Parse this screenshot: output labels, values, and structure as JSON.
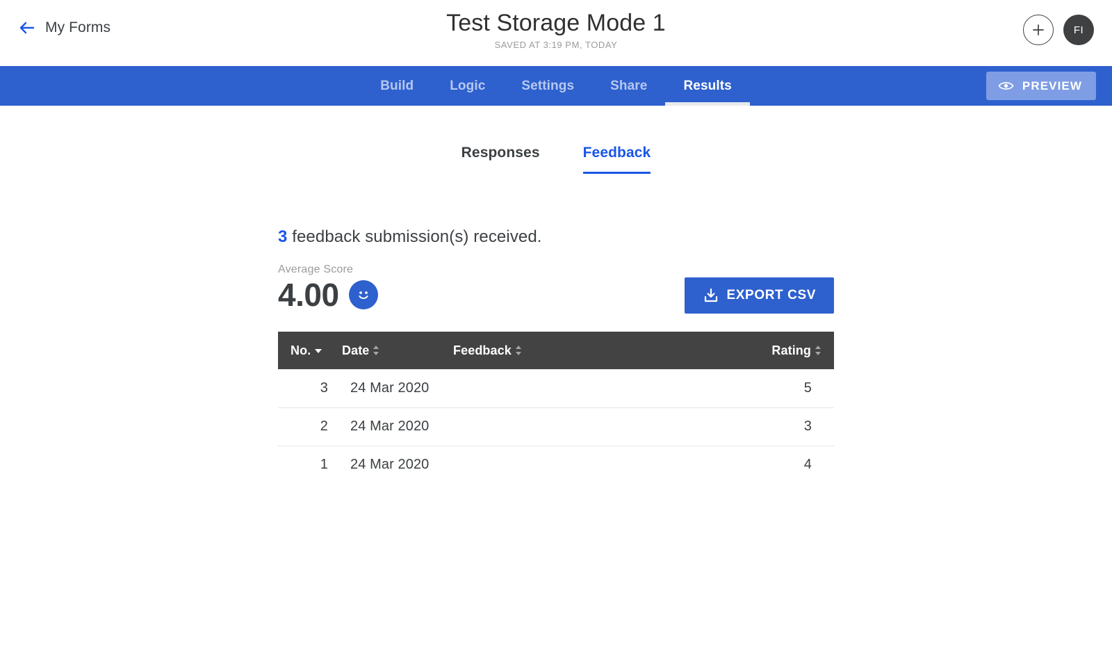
{
  "header": {
    "back_label": "My Forms",
    "back_icon": "arrow-left-icon",
    "title": "Test Storage Mode 1",
    "saved_text": "SAVED AT 3:19 PM, TODAY",
    "add_icon": "plus-icon",
    "avatar_initials": "FI"
  },
  "nav": {
    "tabs": [
      {
        "label": "Build",
        "active": false
      },
      {
        "label": "Logic",
        "active": false
      },
      {
        "label": "Settings",
        "active": false
      },
      {
        "label": "Share",
        "active": false
      },
      {
        "label": "Results",
        "active": true
      }
    ],
    "preview_label": "PREVIEW",
    "preview_icon": "eye-icon"
  },
  "subtabs": [
    {
      "label": "Responses",
      "active": false
    },
    {
      "label": "Feedback",
      "active": true
    }
  ],
  "summary": {
    "count": "3",
    "text": " feedback submission(s) received."
  },
  "score": {
    "label": "Average Score",
    "value": "4.00",
    "face_icon": "smiley-face-icon"
  },
  "export": {
    "label": "EXPORT CSV",
    "icon": "download-icon"
  },
  "table": {
    "columns": [
      {
        "label": "No.",
        "sort": "desc"
      },
      {
        "label": "Date",
        "sort": "both"
      },
      {
        "label": "Feedback",
        "sort": "both"
      },
      {
        "label": "Rating",
        "sort": "both"
      }
    ],
    "rows": [
      {
        "no": "3",
        "date": "24 Mar 2020",
        "feedback": "",
        "rating": "5"
      },
      {
        "no": "2",
        "date": "24 Mar 2020",
        "feedback": "",
        "rating": "3"
      },
      {
        "no": "1",
        "date": "24 Mar 2020",
        "feedback": "",
        "rating": "4"
      }
    ]
  },
  "colors": {
    "brand_blue": "#2e60ce",
    "accent_blue": "#1a56e8",
    "preview_blue": "#7f9de4",
    "table_header": "#434343",
    "text_dark": "#3c4043",
    "text_muted": "#9b9b9b"
  }
}
